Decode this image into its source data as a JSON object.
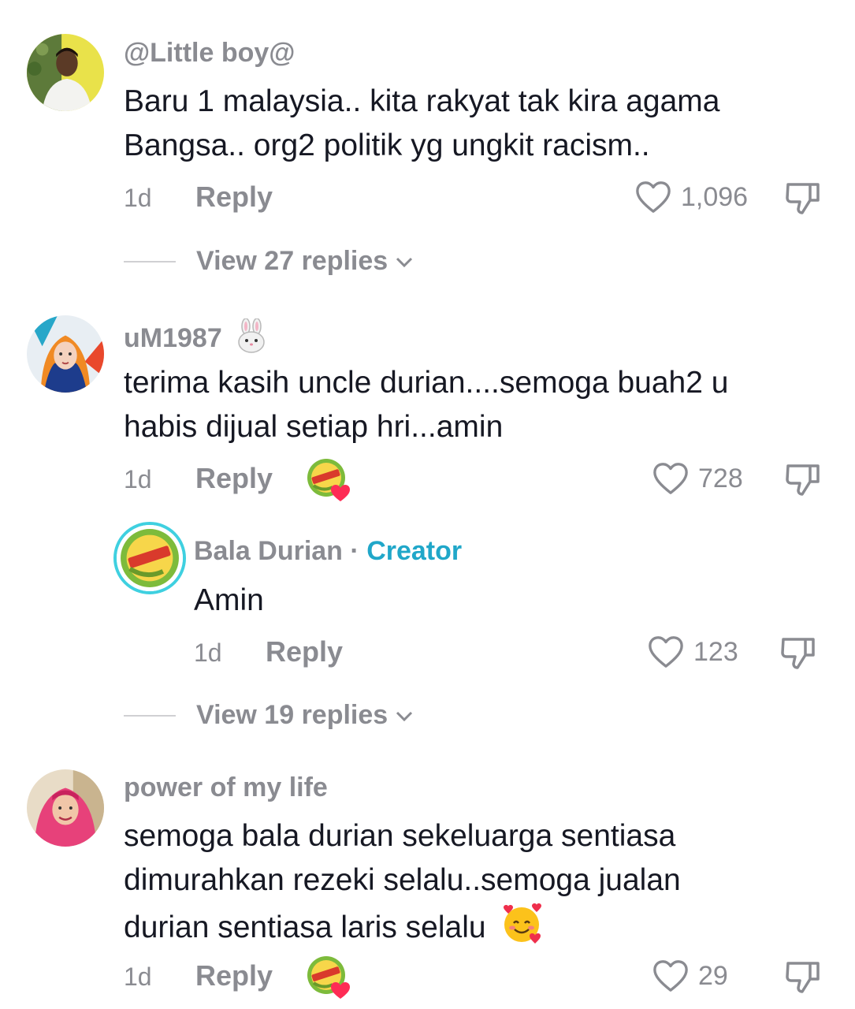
{
  "comments": [
    {
      "username": "@Little boy@",
      "text_lines": [
        "Baru 1 malaysia.. kita rakyat tak kira agama",
        "Bangsa.. org2 politik yg ungkit racism.."
      ],
      "time": "1d",
      "reply_label": "Reply",
      "likes": "1,096",
      "view_replies": "View 27 replies"
    },
    {
      "username": "uM1987",
      "username_emoji": "rabbit-face-icon",
      "text_lines": [
        "terima kasih uncle durian....semoga buah2 u",
        "habis dijual setiap hri...amin"
      ],
      "time": "1d",
      "reply_label": "Reply",
      "likes": "728",
      "creator_liked": true
    },
    {
      "username": "Bala Durian",
      "separator": "·",
      "creator_tag": "Creator",
      "text_lines": [
        "Amin"
      ],
      "time": "1d",
      "reply_label": "Reply",
      "likes": "123",
      "view_replies": "View 19 replies"
    },
    {
      "username": "power of my life",
      "text_lines": [
        "semoga bala durian sekeluarga sentiasa",
        "dimurahkan rezeki selalu..semoga jualan",
        "durian sentiasa laris selalu"
      ],
      "trailing_emoji": "smiling-face-with-hearts-icon",
      "time": "1d",
      "reply_label": "Reply",
      "likes": "29",
      "creator_liked": true
    }
  ],
  "colors": {
    "text": "#161823",
    "muted": "#8a8b91",
    "creator": "#20a7c9"
  }
}
